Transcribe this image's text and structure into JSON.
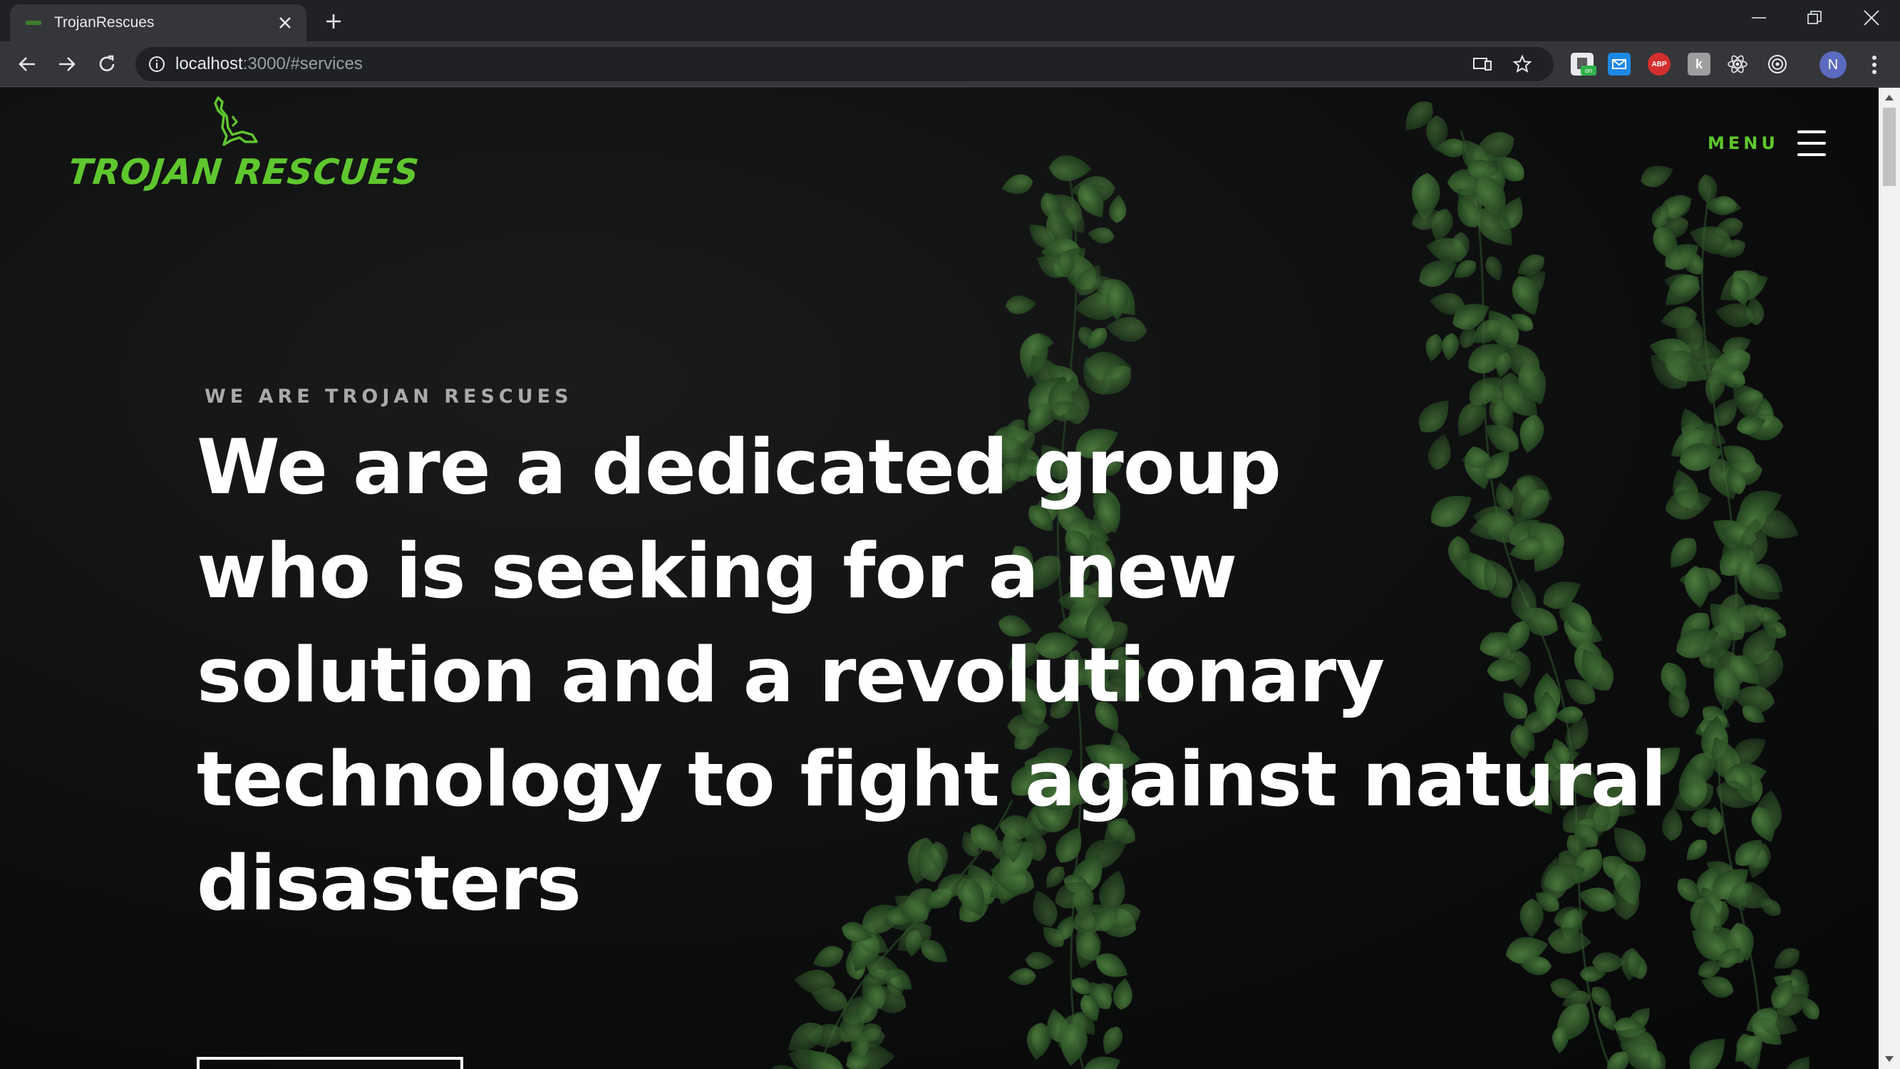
{
  "browser": {
    "tab_title": "TrojanRescues",
    "url_host": "localhost",
    "url_path": ":3000/#services",
    "avatar_letter": "N",
    "extensions": [
      "pushbullet-icon",
      "mail-icon",
      "adblock-icon",
      "k-icon",
      "react-icon",
      "target-icon"
    ],
    "extension_badge": "on"
  },
  "page": {
    "logo_text": "TROJAN RESCUES",
    "menu_label": "MENU",
    "eyebrow": "WE ARE TROJAN RESCUES",
    "headline_lines": [
      "We are a dedicated group",
      "who is seeking for a new",
      "solution and a revolutionary",
      "technology to fight against natural",
      "disasters"
    ]
  },
  "colors": {
    "brand_green": "#5fc72e",
    "text_white": "#ffffff",
    "eyebrow_gray": "#a9aaaa",
    "background": "#0c0d0d",
    "leaf_green": "#2f5a2a"
  }
}
